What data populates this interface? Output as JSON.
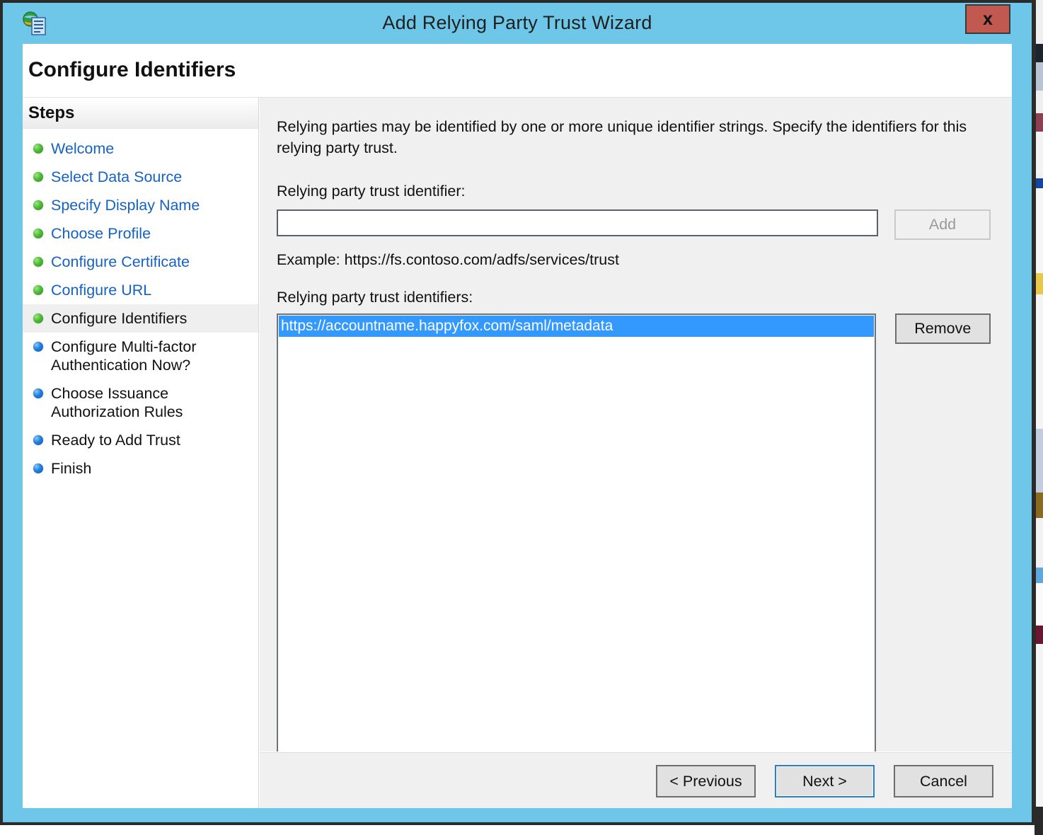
{
  "window": {
    "title": "Add Relying Party Trust Wizard",
    "icon": "network-document-icon",
    "close_label": "x",
    "titlebar_color": "#6ec6e8",
    "close_button_color": "#c05a51"
  },
  "page": {
    "title": "Configure Identifiers"
  },
  "sidebar": {
    "heading": "Steps",
    "items": [
      {
        "label": "Welcome",
        "state": "done"
      },
      {
        "label": "Select Data Source",
        "state": "done"
      },
      {
        "label": "Specify Display Name",
        "state": "done"
      },
      {
        "label": "Choose Profile",
        "state": "done"
      },
      {
        "label": "Configure Certificate",
        "state": "done"
      },
      {
        "label": "Configure URL",
        "state": "done"
      },
      {
        "label": "Configure Identifiers",
        "state": "current"
      },
      {
        "label": "Configure Multi-factor Authentication Now?",
        "state": "todo"
      },
      {
        "label": "Choose Issuance Authorization Rules",
        "state": "todo"
      },
      {
        "label": "Ready to Add Trust",
        "state": "todo"
      },
      {
        "label": "Finish",
        "state": "todo"
      }
    ],
    "done_color": "#1562c5",
    "done_dot_color": "#4fbb33",
    "todo_dot_color": "#1f7fe0"
  },
  "main": {
    "intro": "Relying parties may be identified by one or more unique identifier strings. Specify the identifiers for this relying party trust.",
    "identifier_label": "Relying party trust identifier:",
    "identifier_value": "",
    "identifier_placeholder": "",
    "add_button": "Add",
    "add_button_enabled": "false",
    "example": "Example: https://fs.contoso.com/adfs/services/trust",
    "list_label": "Relying party trust identifiers:",
    "list_items": [
      "https://accountname.happyfox.com/saml/metadata"
    ],
    "selected_index": 0,
    "selection_color": "#3399ff",
    "remove_button": "Remove"
  },
  "footer": {
    "previous_button": "< Previous",
    "next_button": "Next >",
    "cancel_button": "Cancel",
    "focused_button": "Next >"
  }
}
